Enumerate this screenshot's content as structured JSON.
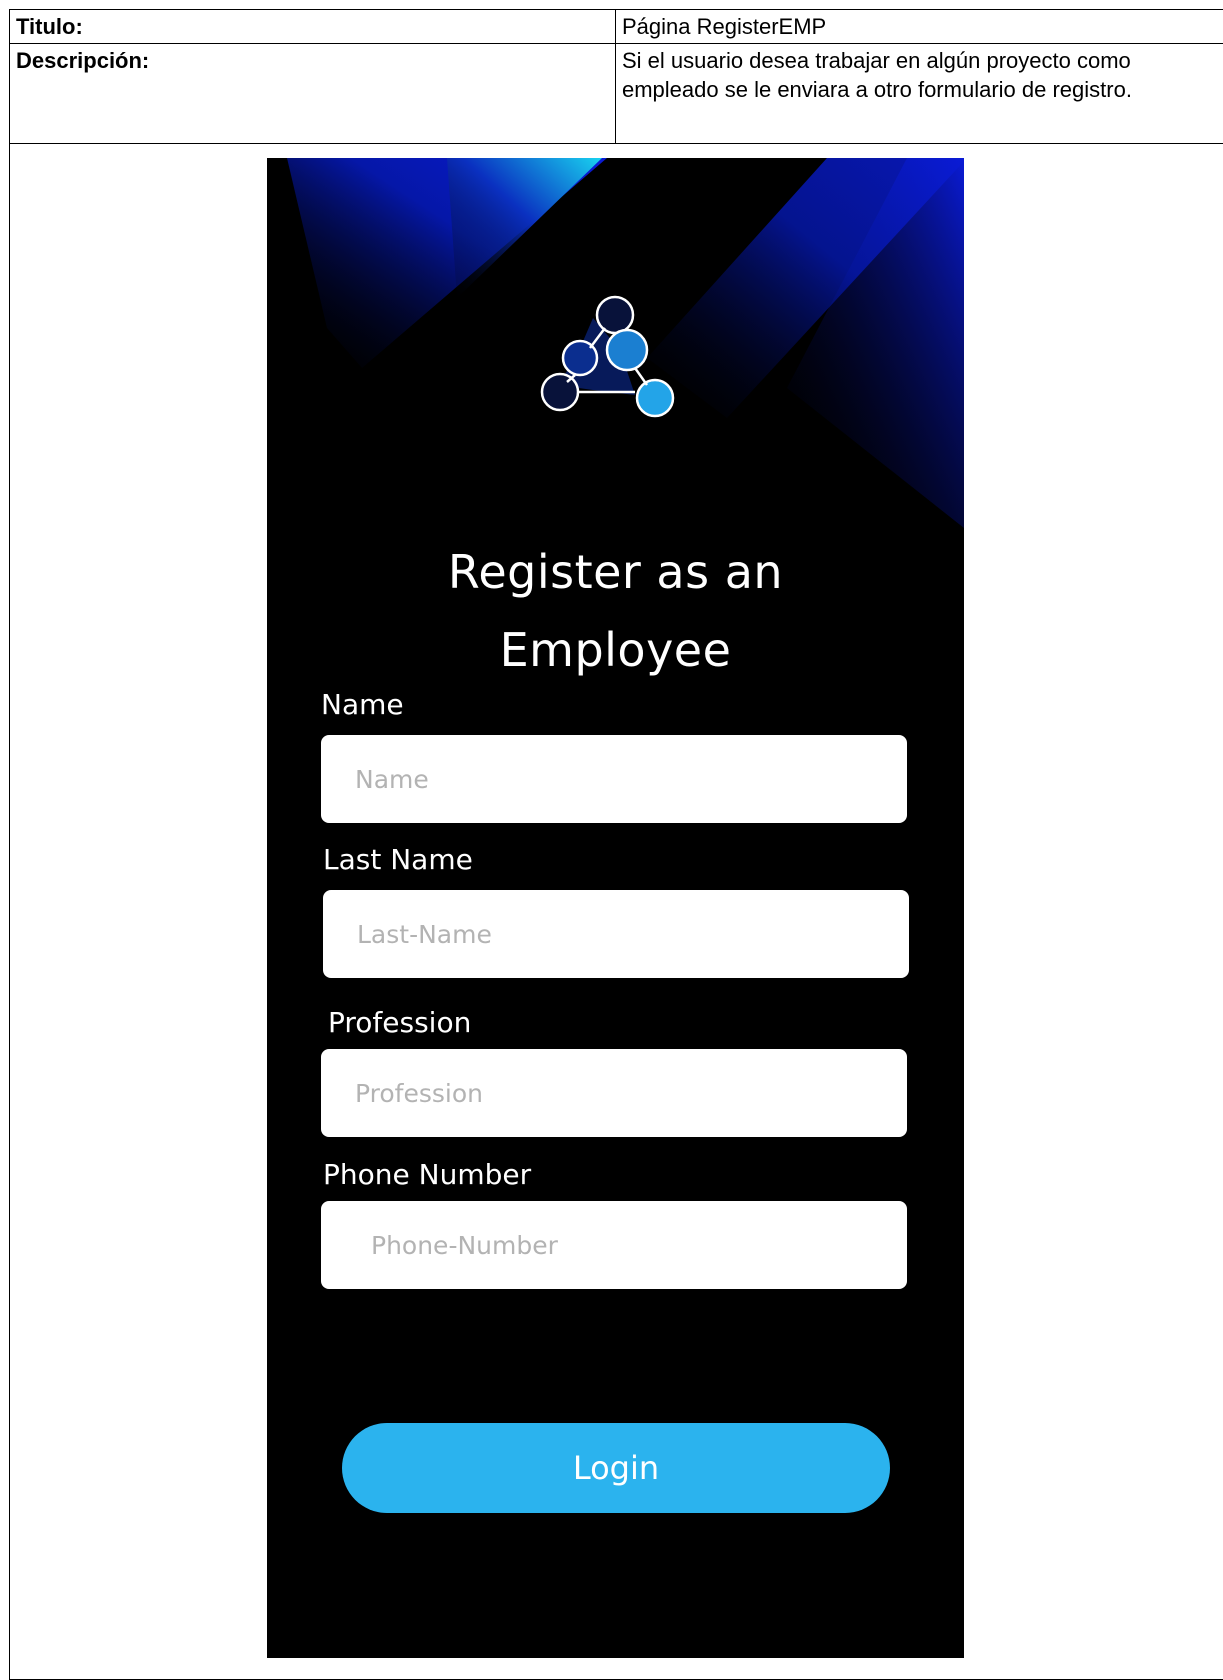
{
  "doc": {
    "rows": [
      {
        "label": "Titulo:",
        "value": "Página RegisterEMP"
      },
      {
        "label": "Descripción:",
        "value": "Si el usuario desea trabajar en algún proyecto como empleado se le enviara a otro formulario de registro."
      }
    ]
  },
  "app": {
    "title_line1": "Register as an",
    "title_line2": "Employee",
    "fields": [
      {
        "label": "Name",
        "placeholder": "Name"
      },
      {
        "label": "Last Name",
        "placeholder": "Last-Name"
      },
      {
        "label": "Profession",
        "placeholder": "Profession"
      },
      {
        "label": "Phone Number",
        "placeholder": "Phone-Number"
      }
    ],
    "submit_label": "Login",
    "colors": {
      "accent": "#2bb3ee",
      "background": "#000000",
      "gradient_blue": "#0a1bd6",
      "gradient_cyan": "#19d3f0"
    },
    "logo_icon": "molecule-logo-icon"
  }
}
